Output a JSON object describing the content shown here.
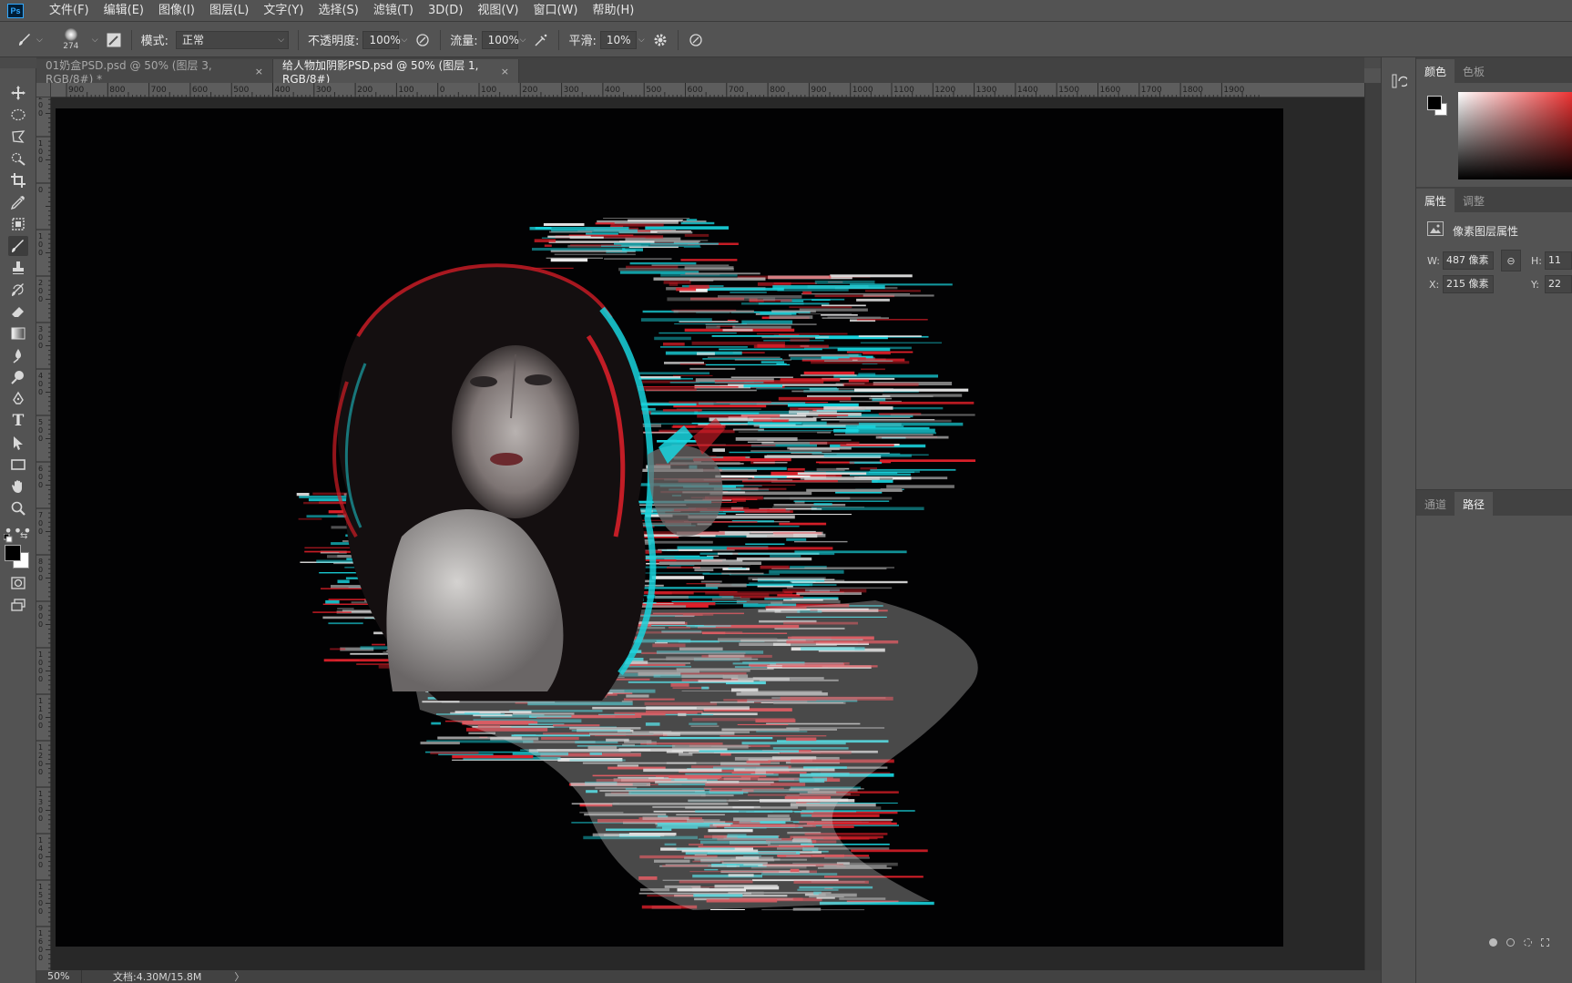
{
  "app": {
    "logo": "Ps"
  },
  "menu": [
    "文件(F)",
    "编辑(E)",
    "图像(I)",
    "图层(L)",
    "文字(Y)",
    "选择(S)",
    "滤镜(T)",
    "3D(D)",
    "视图(V)",
    "窗口(W)",
    "帮助(H)"
  ],
  "options": {
    "brush_size": "274",
    "mode_label": "模式:",
    "mode_value": "正常",
    "opacity_label": "不透明度:",
    "opacity_value": "100%",
    "flow_label": "流量:",
    "flow_value": "100%",
    "smooth_label": "平滑:",
    "smooth_value": "10%"
  },
  "tabs": [
    {
      "label": "01奶盒PSD.psd @ 50% (图层 3, RGB/8#) *",
      "close": "×"
    },
    {
      "label": "给人物加阴影PSD.psd @ 50% (图层 1, RGB/8#)",
      "close": "×"
    }
  ],
  "ruler_top_labels": [
    "900",
    "800",
    "700",
    "600",
    "500",
    "400",
    "300",
    "200",
    "100",
    "0",
    "100",
    "200",
    "300",
    "400",
    "500",
    "600",
    "700",
    "800",
    "900",
    "1000",
    "1100",
    "1200",
    "1300",
    "1400",
    "1500",
    "1600",
    "1700",
    "1800",
    "1900"
  ],
  "ruler_left_labels": [
    "200",
    "100",
    "0",
    "100",
    "200",
    "300",
    "400",
    "500",
    "600",
    "700",
    "800",
    "900",
    "1000",
    "1100",
    "1200",
    "1300",
    "1400",
    "1500",
    "1600"
  ],
  "status": {
    "zoom": "50%",
    "doc_info": "文档:4.30M/15.8M",
    "arrow": "〉"
  },
  "color_panel": {
    "tabs": [
      "颜色",
      "色板"
    ]
  },
  "properties_panel": {
    "tabs": [
      "属性",
      "调整"
    ],
    "layer_type": "像素图层属性",
    "w_label": "W:",
    "w_value": "487 像素",
    "h_label": "H:",
    "h_value": "11",
    "x_label": "X:",
    "x_value": "215 像素",
    "y_label": "Y:",
    "y_value": "22"
  },
  "paths_panel": {
    "tabs": [
      "通道",
      "路径"
    ]
  },
  "colors": {
    "accent_red": "#e0202a",
    "accent_cyan": "#19d6e0",
    "ui_bg": "#535353"
  }
}
